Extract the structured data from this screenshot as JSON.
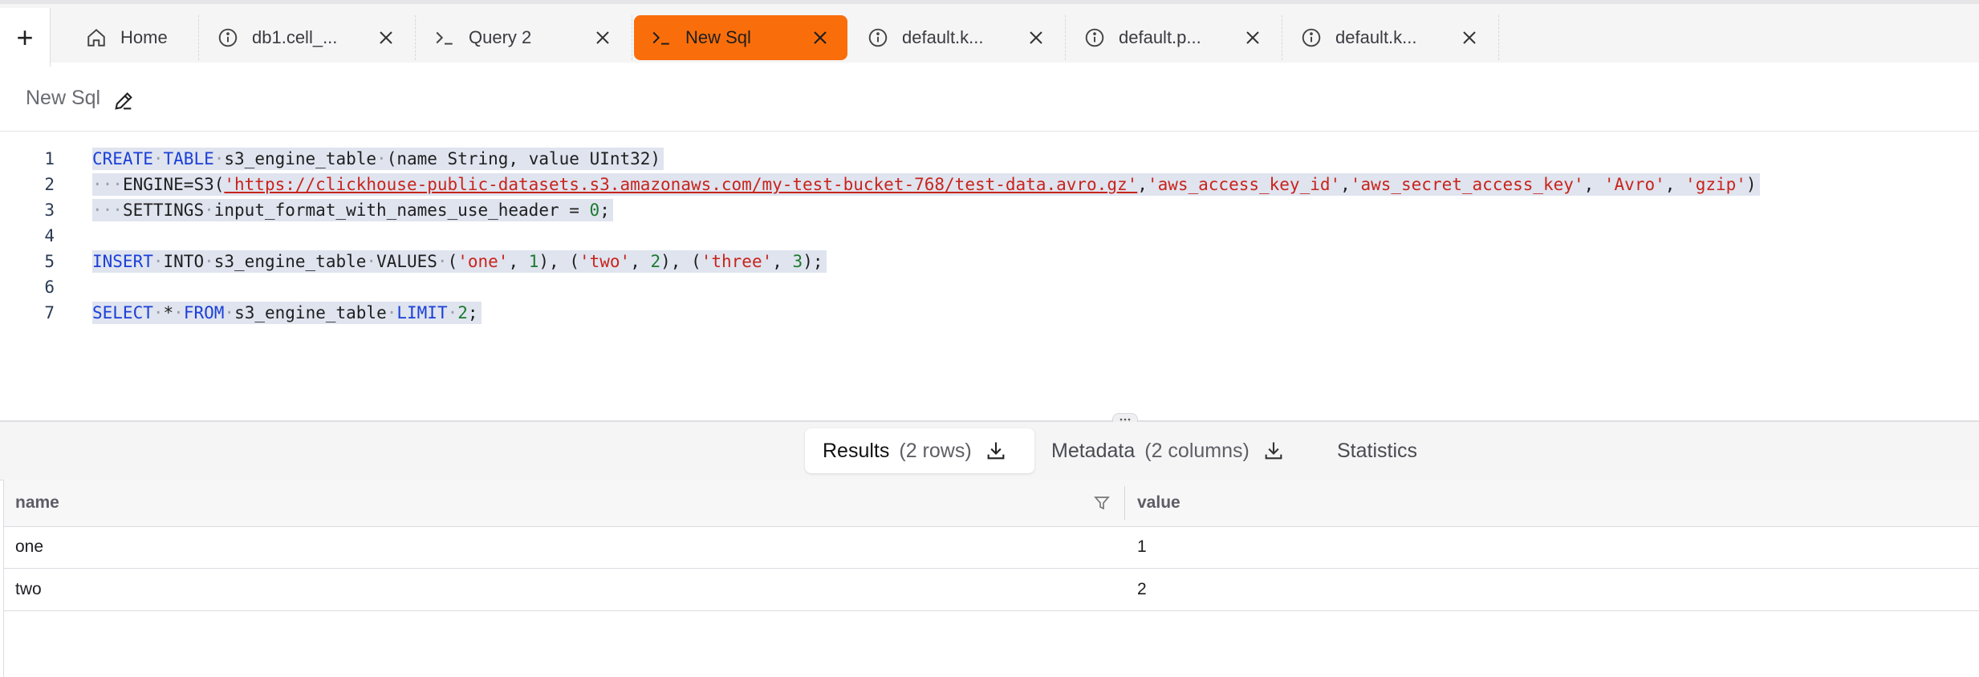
{
  "tabs": {
    "add_label": "+",
    "items": [
      {
        "label": "Home",
        "icon": "home-icon"
      },
      {
        "label": "db1.cell_...",
        "icon": "info-icon"
      },
      {
        "label": "Query 2",
        "icon": "terminal-icon"
      },
      {
        "label": "New Sql",
        "icon": "terminal-icon"
      },
      {
        "label": "default.k...",
        "icon": "info-icon"
      },
      {
        "label": "default.p...",
        "icon": "info-icon"
      },
      {
        "label": "default.k...",
        "icon": "info-icon"
      }
    ],
    "active_color": "#f96e0b"
  },
  "query": {
    "title": "New Sql",
    "line_numbers": [
      "1",
      "2",
      "3",
      "4",
      "5",
      "6",
      "7"
    ],
    "code": {
      "l1": {
        "kw1": "CREATE",
        "kw2": "TABLE",
        "ident": "s3_engine_table",
        "paren": "(name String, value UInt32)"
      },
      "l2": {
        "prefix": "ENGINE=S3(",
        "url": "'https://clickhouse-public-datasets.s3.amazonaws.com/my-test-bucket-768/test-data.avro.gz'",
        "sep1": ",",
        "s1": "'aws_access_key_id'",
        "sep2": ",",
        "s2": "'aws_secret_access_key'",
        "sep3": ", ",
        "s3": "'Avro'",
        "sep4": ", ",
        "s4": "'gzip'",
        "close": ")"
      },
      "l3": {
        "kw": "SETTINGS",
        "rest": "input_format_with_names_use_header = ",
        "num": "0",
        "end": ";"
      },
      "l5": {
        "kw1": "INSERT",
        "kw2": "INTO",
        "ident": "s3_engine_table",
        "kw3": "VALUES",
        "p1": "(",
        "s1": "'one'",
        "c1": ", ",
        "n1": "1",
        "p2": "), (",
        "s2": "'two'",
        "c2": ", ",
        "n2": "2",
        "p3": "), (",
        "s3": "'three'",
        "c3": ", ",
        "n3": "3",
        "end": ");"
      },
      "l7": {
        "kw1": "SELECT",
        "star": "*",
        "kw2": "FROM",
        "ident": "s3_engine_table",
        "kw3": "LIMIT",
        "num": "2",
        "end": ";"
      }
    }
  },
  "results": {
    "tabs": {
      "results": {
        "label": "Results",
        "count": "(2 rows)"
      },
      "metadata": {
        "label": "Metadata",
        "count": "(2 columns)"
      },
      "statistics": {
        "label": "Statistics"
      }
    },
    "columns": [
      "name",
      "value"
    ],
    "rows": [
      [
        "one",
        "1"
      ],
      [
        "two",
        "2"
      ]
    ]
  }
}
